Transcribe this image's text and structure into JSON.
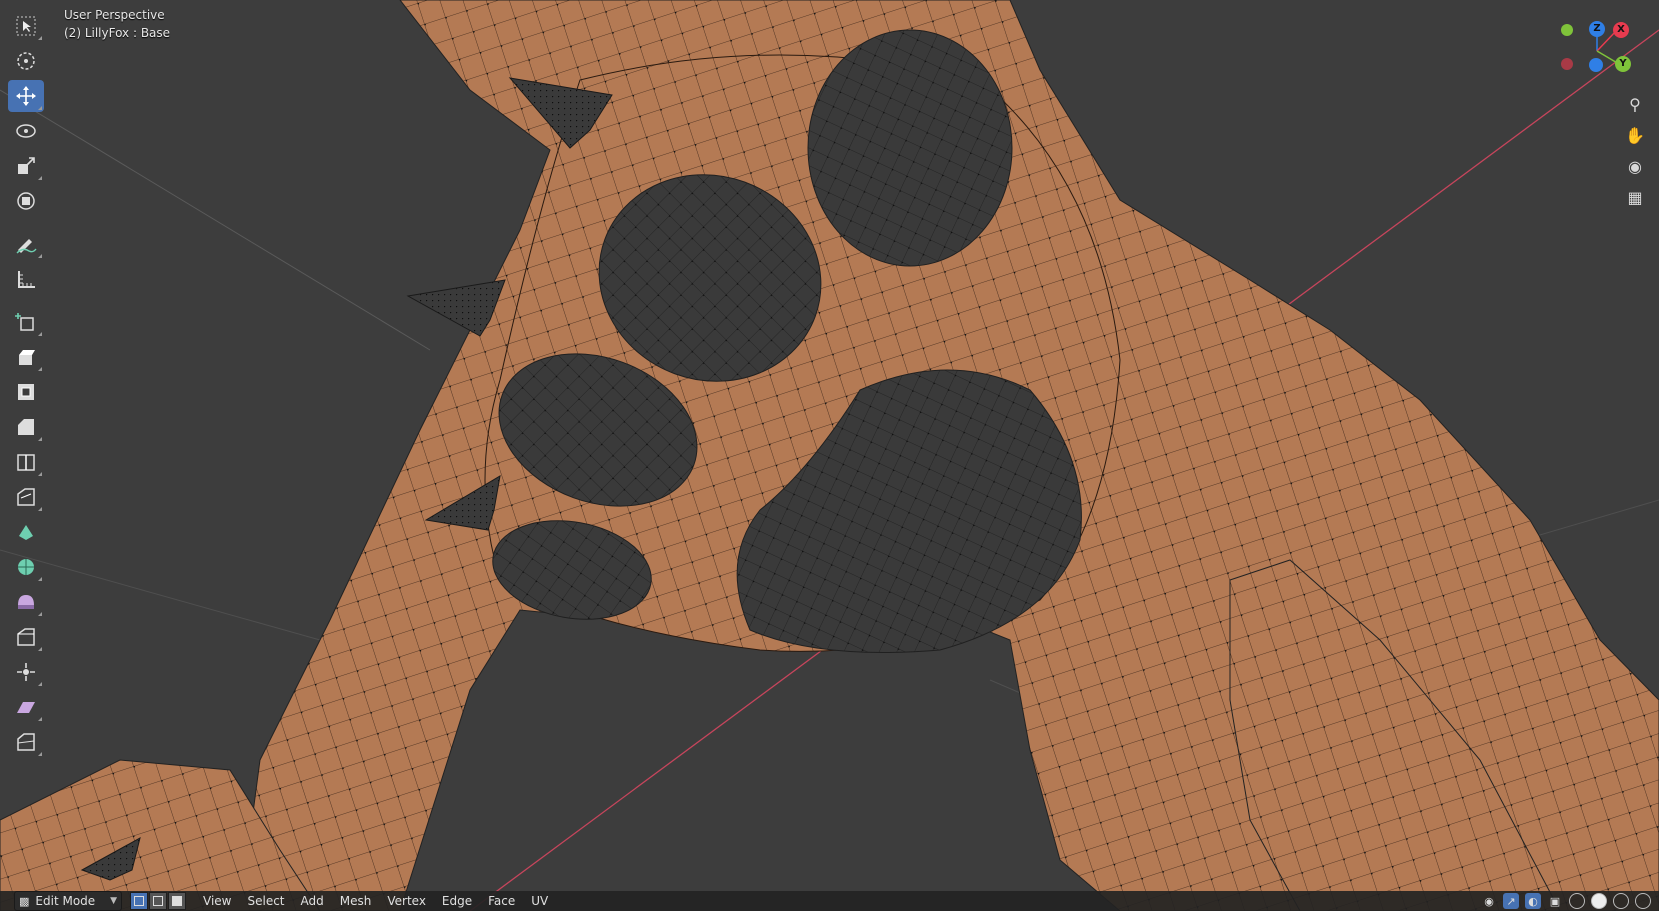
{
  "viewport": {
    "view_name": "User Perspective",
    "object_info": "(2) LillyFox : Base",
    "mesh_color": "#b47a54",
    "pad_color": "#3a3a3a",
    "background": "#3d3d3d"
  },
  "toolbar": {
    "tools": [
      {
        "name": "select-box",
        "icon": "cursor-arrow-icon",
        "active": false
      },
      {
        "name": "cursor",
        "icon": "3d-cursor-icon",
        "active": false
      },
      {
        "name": "move",
        "icon": "move-arrows-icon",
        "active": true
      },
      {
        "name": "rotate",
        "icon": "rotate-icon",
        "active": false
      },
      {
        "name": "scale",
        "icon": "scale-icon",
        "active": false
      },
      {
        "name": "transform",
        "icon": "transform-icon",
        "active": false
      },
      {
        "name": "annotate",
        "icon": "pencil-icon",
        "active": false
      },
      {
        "name": "measure",
        "icon": "ruler-icon",
        "active": false
      },
      {
        "name": "add-cube",
        "icon": "add-cube-icon",
        "active": false
      },
      {
        "name": "extrude",
        "icon": "extrude-icon",
        "active": false
      },
      {
        "name": "inset",
        "icon": "inset-icon",
        "active": false
      },
      {
        "name": "bevel",
        "icon": "bevel-icon",
        "active": false
      },
      {
        "name": "loop-cut",
        "icon": "loop-cut-icon",
        "active": false
      },
      {
        "name": "knife",
        "icon": "knife-icon",
        "active": false
      },
      {
        "name": "poly-build",
        "icon": "poly-build-icon",
        "active": false
      },
      {
        "name": "spin",
        "icon": "spin-icon",
        "active": false
      },
      {
        "name": "smooth",
        "icon": "smooth-icon",
        "active": false
      },
      {
        "name": "edge-slide",
        "icon": "edge-slide-icon",
        "active": false
      },
      {
        "name": "shrink-fatten",
        "icon": "shrink-fatten-icon",
        "active": false
      },
      {
        "name": "shear",
        "icon": "shear-icon",
        "active": false
      },
      {
        "name": "rip",
        "icon": "rip-icon",
        "active": false
      }
    ]
  },
  "gizmo": {
    "z_label": "Z",
    "x_label": "X",
    "y_label": "Y",
    "z_color": "#2f7fe6",
    "x_color": "#e83b4f",
    "y_color": "#7fc33a"
  },
  "header": {
    "mode": "Edit Mode",
    "menus": [
      "View",
      "Select",
      "Add",
      "Mesh",
      "Vertex",
      "Edge",
      "Face",
      "UV"
    ]
  }
}
